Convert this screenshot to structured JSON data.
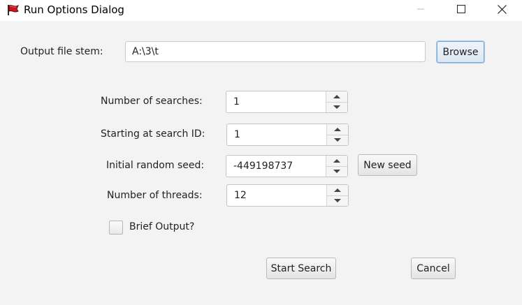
{
  "window": {
    "title": "Run Options Dialog",
    "app_icon": "red-flag-icon",
    "controls": [
      "minimize-icon",
      "maximize-icon",
      "close-icon"
    ]
  },
  "output": {
    "label": "Output file stem:",
    "value": "A:\\3\\t",
    "browse_label": "Browse"
  },
  "num_searches": {
    "label": "Number of searches:",
    "value": "1"
  },
  "start_id": {
    "label": "Starting at search ID:",
    "value": "1"
  },
  "seed": {
    "label": "Initial random seed:",
    "value": "-449198737",
    "new_seed_label": "New seed"
  },
  "threads": {
    "label": "Number of threads:",
    "value": "12"
  },
  "brief": {
    "label": "Brief Output?",
    "checked": false
  },
  "actions": {
    "start_label": "Start Search",
    "cancel_label": "Cancel"
  }
}
